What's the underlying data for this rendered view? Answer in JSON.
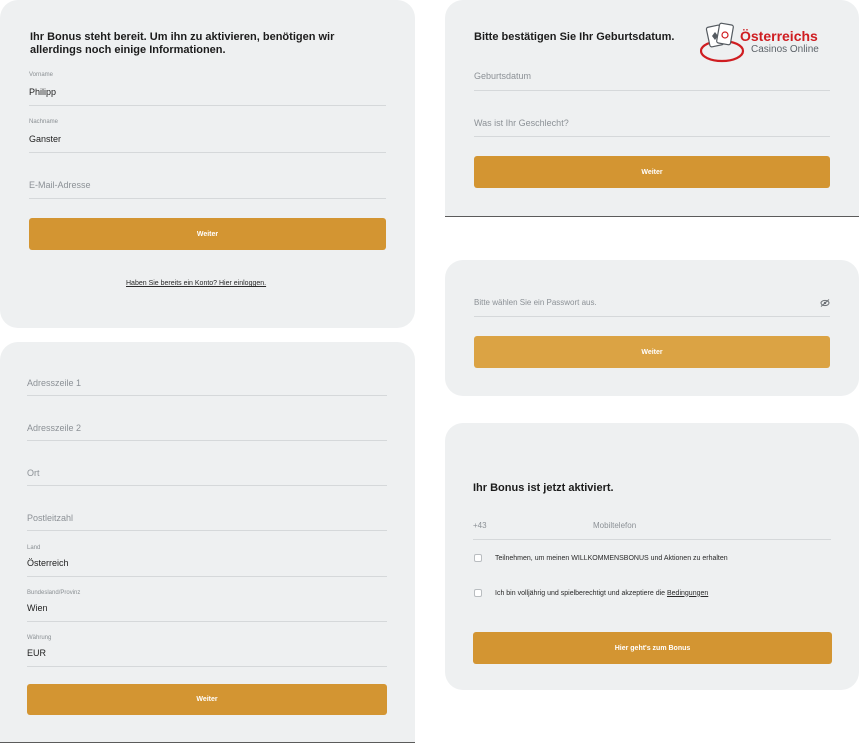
{
  "card1": {
    "title": "Ihr Bonus steht bereit. Um ihn zu aktivieren, benötigen wir allerdings noch einige Informationen.",
    "firstname_label": "Vorname",
    "firstname_value": "Philipp",
    "lastname_label": "Nachname",
    "lastname_value": "Ganster",
    "email_placeholder": "E-Mail-Adresse",
    "button": "Weiter",
    "login_link": "Haben Sie bereits ein Konto? Hier einloggen."
  },
  "card2": {
    "address1_placeholder": "Adresszeile 1",
    "address2_placeholder": "Adresszeile 2",
    "city_placeholder": "Ort",
    "zip_placeholder": "Postleitzahl",
    "country_label": "Land",
    "country_value": "Österreich",
    "state_label": "Bundesland/Provinz",
    "state_value": "Wien",
    "currency_label": "Währung",
    "currency_value": "EUR",
    "button": "Weiter"
  },
  "card3": {
    "title": "Bitte bestätigen Sie Ihr Geburtsdatum.",
    "birthdate_placeholder": "Geburtsdatum",
    "gender_placeholder": "Was ist Ihr Geschlecht?",
    "button": "Weiter"
  },
  "logo": {
    "line1": "Österreichs",
    "line2": "Casinos Online",
    "icon": "playing-cards-chip-icon",
    "accent": "#cf1d21"
  },
  "card4": {
    "password_placeholder": "Bitte wählen Sie ein Passwort aus.",
    "eye_icon": "eye-slash-icon",
    "button": "Weiter"
  },
  "card5": {
    "title": "Ihr Bonus ist jetzt aktiviert.",
    "phone_prefix": "+43",
    "phone_placeholder": "Mobiltelefon",
    "consent_text": "Teilnehmen, um meinen WILLKOMMENSBONUS und Aktionen zu erhalten",
    "terms_text": "Ich bin volljährig und spielberechtigt und akzeptiere die ",
    "terms_link": "Bedingungen",
    "button": "Hier geht's zum Bonus"
  },
  "colors": {
    "button": "#d39532",
    "card_bg": "#eef0f1"
  }
}
